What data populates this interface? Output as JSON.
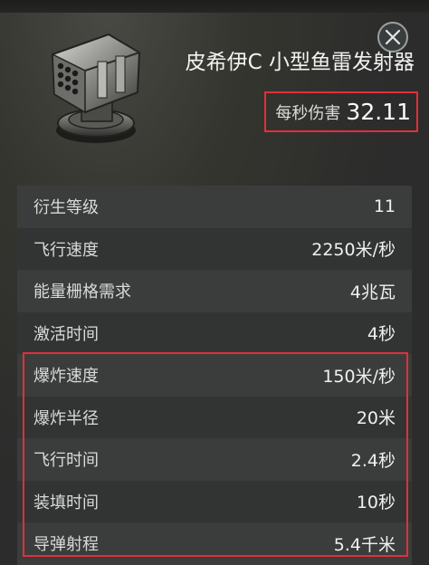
{
  "module": {
    "title": "皮希伊C 小型鱼雷发射器",
    "icon": "torpedo-launcher-icon"
  },
  "close": {
    "icon": "close-icon"
  },
  "dps": {
    "label": "每秒伤害",
    "value": "32.11"
  },
  "stats": [
    {
      "label": "衍生等级",
      "value": "11"
    },
    {
      "label": "飞行速度",
      "value": "2250米/秒"
    },
    {
      "label": "能量栅格需求",
      "value": "4兆瓦"
    },
    {
      "label": "激活时间",
      "value": "4秒"
    },
    {
      "label": "爆炸速度",
      "value": "150米/秒"
    },
    {
      "label": "爆炸半径",
      "value": "20米"
    },
    {
      "label": "飞行时间",
      "value": "2.4秒"
    },
    {
      "label": "装填时间",
      "value": "10秒"
    },
    {
      "label": "导弹射程",
      "value": "5.4千米"
    }
  ],
  "colors": {
    "highlight": "#e0303a",
    "background": "#2b2c2b"
  }
}
